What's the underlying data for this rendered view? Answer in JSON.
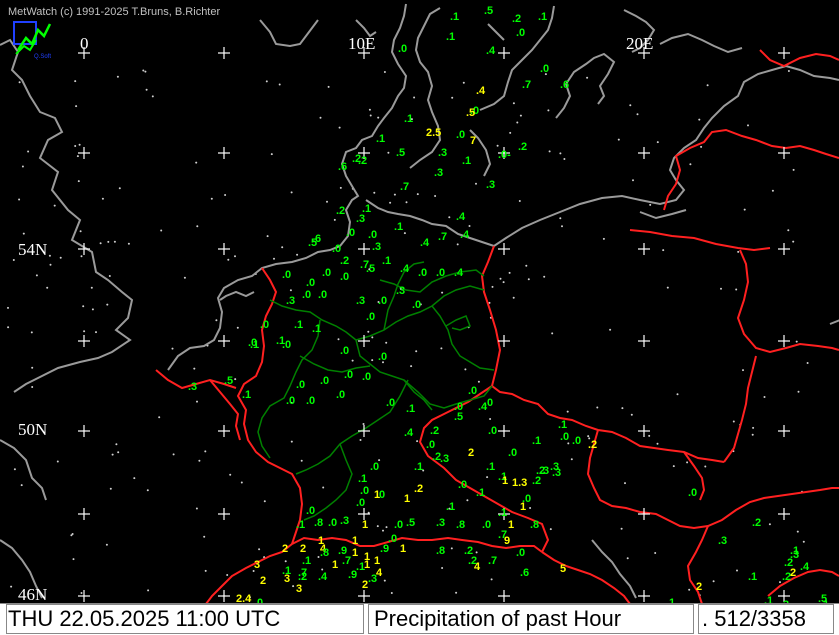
{
  "header": {
    "credit": "MetWatch  (c) 1991-2025 T.Bruns, B.Richter",
    "logo_text": "Q.Soft"
  },
  "grid_labels": {
    "lon": [
      "0",
      "10E",
      "20E"
    ],
    "lat": [
      "54N",
      "50N",
      "46N"
    ]
  },
  "footer": {
    "datetime": "THU 22.05.2025 11:00 UTC",
    "product": "Precipitation of past  Hour",
    "count": ". 512/3358"
  },
  "colors": {
    "background": "#000000",
    "coast": "#9a9a9a",
    "border": "#ff2020",
    "state_border": "#007000",
    "small": "#00ff00",
    "large": "#ffff00"
  },
  "observations": [
    {
      "t": ".1",
      "c": "g"
    },
    {
      "t": ".5",
      "c": "g"
    },
    {
      "t": ".2",
      "c": "g"
    },
    {
      "t": ".1",
      "c": "g"
    },
    {
      "t": ".1",
      "c": "g"
    },
    {
      "t": ".0",
      "c": "g"
    },
    {
      "t": ".0",
      "c": "g"
    },
    {
      "t": ".4",
      "c": "g"
    },
    {
      "t": ".0",
      "c": "g"
    },
    {
      "t": ".4",
      "c": "y"
    },
    {
      "t": ".7",
      "c": "g"
    },
    {
      "t": ".6",
      "c": "g"
    },
    {
      "t": ".0",
      "c": "g"
    },
    {
      "t": ".1",
      "c": "g"
    },
    {
      "t": "2.5",
      "c": "y"
    },
    {
      "t": ".0",
      "c": "g"
    },
    {
      "t": ".5",
      "c": "y"
    },
    {
      "t": ".1",
      "c": "g"
    },
    {
      "t": ".3",
      "c": "g"
    },
    {
      "t": "7",
      "c": "y"
    },
    {
      "t": ".2",
      "c": "g"
    },
    {
      "t": ".0-",
      "c": "g"
    },
    {
      "t": ".2",
      "c": "g"
    },
    {
      "t": ".6",
      "c": "g"
    },
    {
      "t": ".2",
      "c": "g"
    },
    {
      "t": ".5",
      "c": "g"
    },
    {
      "t": ".1",
      "c": "g"
    },
    {
      "t": ".3",
      "c": "g"
    },
    {
      "t": ".3",
      "c": "g"
    },
    {
      "t": ".7",
      "c": "g"
    },
    {
      "t": ".2",
      "c": "g"
    },
    {
      "t": ".1",
      "c": "g"
    },
    {
      "t": ".3",
      "c": "g"
    },
    {
      "t": ".4",
      "c": "g"
    },
    {
      "t": ".0",
      "c": "g"
    },
    {
      "t": ".4",
      "c": "g"
    },
    {
      "t": ".5",
      "c": "g"
    },
    {
      "t": ".6",
      "c": "g"
    },
    {
      "t": ".0",
      "c": "g"
    },
    {
      "t": ".1",
      "c": "g"
    },
    {
      "t": ".4",
      "c": "g"
    },
    {
      "t": ".7",
      "c": "g"
    },
    {
      "t": ".0",
      "c": "g"
    },
    {
      "t": ".3",
      "c": "g"
    },
    {
      "t": ".2",
      "c": "g"
    },
    {
      "t": ".1",
      "c": "g"
    },
    {
      "t": ".4",
      "c": "g"
    },
    {
      "t": ".0",
      "c": "g"
    },
    {
      "t": ".5",
      "c": "g"
    },
    {
      "t": ".7",
      "c": "g"
    },
    {
      "t": ".0",
      "c": "g"
    },
    {
      "t": ".4",
      "c": "g"
    },
    {
      "t": ".0",
      "c": "g"
    },
    {
      "t": ".0",
      "c": "g"
    },
    {
      "t": ".0",
      "c": "g"
    },
    {
      "t": ".0",
      "c": "g"
    },
    {
      "t": ".0",
      "c": "g"
    },
    {
      "t": ".3",
      "c": "g"
    },
    {
      "t": ".0",
      "c": "g"
    },
    {
      "t": ".3",
      "c": "g"
    },
    {
      "t": ".0",
      "c": "g"
    },
    {
      "t": ".0",
      "c": "g"
    },
    {
      "t": ".3",
      "c": "g"
    },
    {
      "t": ".0",
      "c": "g"
    },
    {
      "t": ".1",
      "c": "g"
    },
    {
      "t": ".1",
      "c": "g"
    },
    {
      "t": ".1",
      "c": "g"
    },
    {
      "t": ".0",
      "c": "g"
    },
    {
      "t": ".1",
      "c": "g"
    },
    {
      "t": ".0",
      "c": "g"
    },
    {
      "t": ".0",
      "c": "g"
    },
    {
      "t": ".0",
      "c": "g"
    },
    {
      "t": ".5",
      "c": "g"
    },
    {
      "t": ".3",
      "c": "g"
    },
    {
      "t": ".1",
      "c": "g"
    },
    {
      "t": ".0",
      "c": "g"
    },
    {
      "t": ".0",
      "c": "g"
    },
    {
      "t": ".0",
      "c": "g"
    },
    {
      "t": ".0",
      "c": "g"
    },
    {
      "t": ".0",
      "c": "g"
    },
    {
      "t": ".0",
      "c": "g"
    },
    {
      "t": ".0",
      "c": "g"
    },
    {
      "t": ".0",
      "c": "g"
    },
    {
      "t": ".0",
      "c": "g"
    },
    {
      "t": ".1",
      "c": "g"
    },
    {
      "t": ".0",
      "c": "g"
    },
    {
      "t": ".0",
      "c": "g"
    },
    {
      "t": ".0",
      "c": "g"
    },
    {
      "t": ".4",
      "c": "g"
    },
    {
      "t": ".2",
      "c": "g"
    },
    {
      "t": ".4",
      "c": "g"
    },
    {
      "t": ".0",
      "c": "g"
    },
    {
      "t": ".0",
      "c": "g"
    },
    {
      "t": ".5",
      "c": "g"
    },
    {
      "t": ".1",
      "c": "g"
    },
    {
      "t": ".1",
      "c": "g"
    },
    {
      "t": ".0",
      "c": "g"
    },
    {
      "t": ".0",
      "c": "g"
    },
    {
      "t": ".2",
      "c": "y"
    },
    {
      "t": ".2",
      "c": "g"
    },
    {
      "t": ".1",
      "c": "g"
    },
    {
      "t": ".3",
      "c": "g"
    },
    {
      "t": "2",
      "c": "y"
    },
    {
      "t": ".0",
      "c": "g"
    },
    {
      "t": ".3",
      "c": "g"
    },
    {
      "t": "1.3",
      "c": "y"
    },
    {
      "t": ".1",
      "c": "g"
    },
    {
      "t": ".0",
      "c": "g"
    },
    {
      "t": ".2",
      "c": "y"
    },
    {
      "t": ".0",
      "c": "g"
    },
    {
      "t": ".1",
      "c": "g"
    },
    {
      "t": ".3",
      "c": "g"
    },
    {
      "t": ".2",
      "c": "g"
    },
    {
      "t": ".0",
      "c": "g"
    },
    {
      "t": ".1",
      "c": "g"
    },
    {
      "t": ".0",
      "c": "g"
    },
    {
      "t": "1",
      "c": "y"
    },
    {
      "t": "1",
      "c": "y"
    },
    {
      "t": ".1",
      "c": "g"
    },
    {
      "t": ".0",
      "c": "g"
    },
    {
      "t": ".0",
      "c": "g"
    },
    {
      "t": ".1",
      "c": "g"
    },
    {
      "t": ".1",
      "c": "g"
    },
    {
      "t": "1",
      "c": "y"
    },
    {
      "t": "1",
      "c": "y"
    },
    {
      "t": ".8",
      "c": "g"
    },
    {
      "t": ".8",
      "c": "g"
    },
    {
      "t": ".0",
      "c": "g"
    },
    {
      "t": ".7",
      "c": "g"
    },
    {
      "t": ".3",
      "c": "g"
    },
    {
      "t": ".5",
      "c": "g"
    },
    {
      "t": ".0",
      "c": "g"
    },
    {
      "t": ".0",
      "c": "g"
    },
    {
      "t": ".1",
      "c": "g"
    },
    {
      "t": ".8",
      "c": "g"
    },
    {
      "t": ".0",
      "c": "g"
    },
    {
      "t": ".3",
      "c": "g"
    },
    {
      "t": "1",
      "c": "y"
    },
    {
      "t": "1",
      "c": "y"
    },
    {
      "t": "1",
      "c": "y"
    },
    {
      "t": ".0",
      "c": "g"
    },
    {
      "t": ".9",
      "c": "g"
    },
    {
      "t": "1",
      "c": "y"
    },
    {
      "t": ".8",
      "c": "g"
    },
    {
      "t": ".2",
      "c": "g"
    },
    {
      "t": ".2",
      "c": "g"
    },
    {
      "t": ".7",
      "c": "g"
    },
    {
      "t": "9",
      "c": "y"
    },
    {
      "t": ".0",
      "c": "g"
    },
    {
      "t": ".6",
      "c": "g"
    },
    {
      "t": "2",
      "c": "y"
    },
    {
      "t": "2",
      "c": "y"
    },
    {
      "t": "4",
      "c": "y"
    },
    {
      "t": ".9",
      "c": "g"
    },
    {
      "t": "1",
      "c": "y"
    },
    {
      "t": "1",
      "c": "y"
    },
    {
      "t": ".8",
      "c": "g"
    },
    {
      "t": ".1",
      "c": "g"
    },
    {
      "t": "1",
      "c": "y"
    },
    {
      "t": ".7",
      "c": "g"
    },
    {
      "t": "1",
      "c": "y"
    },
    {
      "t": "1",
      "c": "y"
    },
    {
      "t": "3",
      "c": "y"
    },
    {
      "t": ".1",
      "c": "g"
    },
    {
      "t": ".7",
      "c": "g"
    },
    {
      "t": ".4",
      "c": "g"
    },
    {
      "t": ".9",
      "c": "g"
    },
    {
      "t": "4",
      "c": "y"
    },
    {
      "t": "2",
      "c": "y"
    },
    {
      "t": "3",
      "c": "y"
    },
    {
      "t": ".2",
      "c": "g"
    },
    {
      "t": "3",
      "c": "y"
    },
    {
      "t": "2.4",
      "c": "y"
    },
    {
      "t": ".0",
      "c": "g"
    },
    {
      "t": "2",
      "c": "y"
    },
    {
      "t": ".1",
      "c": "g"
    },
    {
      "t": ".3",
      "c": "g"
    },
    {
      "t": "5",
      "c": "y"
    },
    {
      "t": ".2",
      "c": "g"
    },
    {
      "t": "2",
      "c": "y"
    },
    {
      "t": ".3",
      "c": "g"
    },
    {
      "t": ".1",
      "c": "g"
    },
    {
      "t": ".3",
      "c": "g"
    },
    {
      "t": ".2",
      "c": "g"
    },
    {
      "t": "2",
      "c": "y"
    },
    {
      "t": ".1",
      "c": "g"
    },
    {
      "t": ".5",
      "c": "g"
    },
    {
      "t": ".3",
      "c": "g"
    },
    {
      "t": ".1",
      "c": "g"
    },
    {
      "t": ".1",
      "c": "g"
    },
    {
      "t": ".1",
      "c": "g"
    },
    {
      "t": ".4",
      "c": "g"
    },
    {
      "t": ".0",
      "c": "g"
    },
    {
      "t": ".2",
      "c": "g"
    },
    {
      "t": ".3",
      "c": "g"
    },
    {
      "t": "1",
      "c": "y"
    },
    {
      "t": "4",
      "c": "y"
    },
    {
      "t": ".2",
      "c": "g"
    }
  ]
}
